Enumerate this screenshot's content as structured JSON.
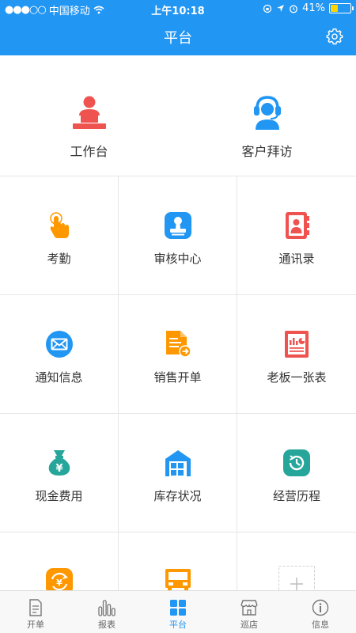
{
  "status_bar": {
    "carrier": "中国移动",
    "time": "上午10:18",
    "battery": "41%",
    "battery_level": 0.41
  },
  "header": {
    "title": "平台"
  },
  "top_items": [
    {
      "label": "工作台",
      "icon": "workbench-icon"
    },
    {
      "label": "客户拜访",
      "icon": "headset-icon"
    }
  ],
  "grid_items": [
    {
      "label": "考勤",
      "icon": "touch-icon"
    },
    {
      "label": "审核中心",
      "icon": "stamp-icon"
    },
    {
      "label": "通讯录",
      "icon": "contacts-icon"
    },
    {
      "label": "通知信息",
      "icon": "envelope-icon"
    },
    {
      "label": "销售开单",
      "icon": "sales-doc-icon"
    },
    {
      "label": "老板一张表",
      "icon": "report-icon"
    },
    {
      "label": "现金费用",
      "icon": "money-bag-icon"
    },
    {
      "label": "库存状况",
      "icon": "warehouse-icon"
    },
    {
      "label": "经营历程",
      "icon": "history-icon"
    }
  ],
  "tabs": [
    {
      "label": "开单",
      "icon": "document-icon"
    },
    {
      "label": "报表",
      "icon": "bar-chart-icon"
    },
    {
      "label": "平台",
      "icon": "grid-icon",
      "active": true
    },
    {
      "label": "巡店",
      "icon": "store-icon"
    },
    {
      "label": "信息",
      "icon": "info-icon"
    }
  ],
  "colors": {
    "primary": "#2196f3",
    "red": "#ef5350",
    "orange": "#ff9800",
    "green": "#26a69a"
  }
}
